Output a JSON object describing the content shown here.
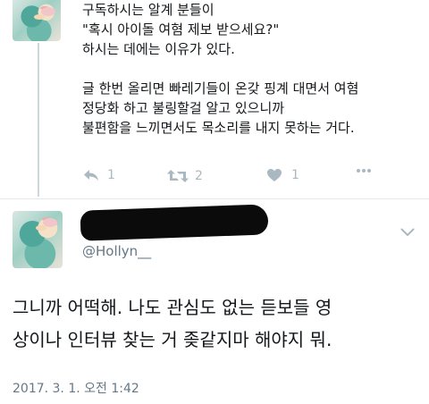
{
  "first_tweet": {
    "lines": [
      "구독하시는 알계 분들이",
      "\"혹시 아이돌 여혐 제보 받으세요?\"",
      "하시는 데에는 이유가 있다.",
      "",
      "글 한번 올리면 빠레기들이 온갖 핑계 대면서 여혐",
      "정당화 하고 불링할걸 알고 있으니까",
      "불편함을 느끼면서도 목소리를 내지 못하는 거다."
    ],
    "actions": {
      "reply_count": "1",
      "retweet_count": "2",
      "like_count": "1"
    }
  },
  "second_tweet": {
    "handle": "@Hollyn__",
    "text_lines": [
      "그니까 어떡해. 나도 관심도 없는 듣보들 영",
      "상이나 인터뷰 찾는 거 좆같지마 해야지 뭐."
    ],
    "timestamp": "2017. 3. 1. 오전 1:42"
  },
  "icons": [
    "reply-icon",
    "retweet-icon",
    "heart-icon",
    "more-icon",
    "chevron-down-icon"
  ],
  "colors": {
    "muted": "#aab8c2",
    "secondary_text": "#657786",
    "text": "#14171a",
    "divider": "#e1e8ed"
  }
}
